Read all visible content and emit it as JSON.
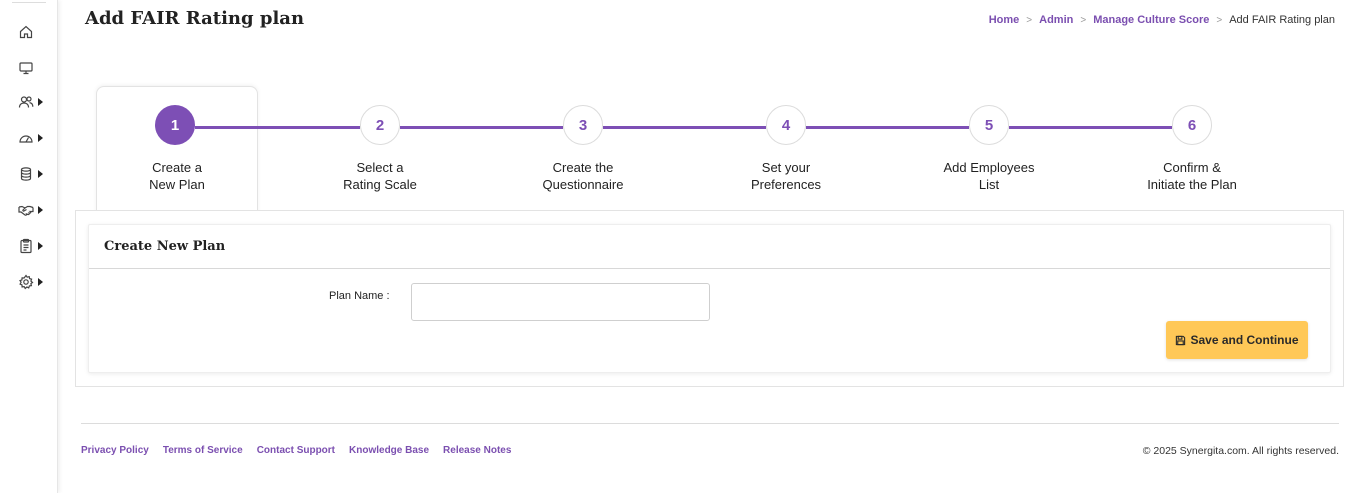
{
  "header": {
    "title": "Add FAIR Rating plan",
    "breadcrumb": [
      "Home",
      "Admin",
      "Manage Culture Score",
      "Add FAIR Rating plan"
    ]
  },
  "sidebar": {
    "items": [
      {
        "icon": "home-icon",
        "has_submenu": false
      },
      {
        "icon": "monitor-icon",
        "has_submenu": false
      },
      {
        "icon": "users-icon",
        "has_submenu": true
      },
      {
        "icon": "gauge-icon",
        "has_submenu": true
      },
      {
        "icon": "database-icon",
        "has_submenu": true
      },
      {
        "icon": "handshake-icon",
        "has_submenu": true
      },
      {
        "icon": "clipboard-icon",
        "has_submenu": true
      },
      {
        "icon": "settings-icon",
        "has_submenu": true
      }
    ]
  },
  "stepper": {
    "active_step": 1,
    "accent_color": "#7d4fb5",
    "steps": [
      {
        "number": "1",
        "line1": "Create a",
        "line2": "New Plan"
      },
      {
        "number": "2",
        "line1": "Select a",
        "line2": "Rating Scale"
      },
      {
        "number": "3",
        "line1": "Create the",
        "line2": "Questionnaire"
      },
      {
        "number": "4",
        "line1": "Set your",
        "line2": "Preferences"
      },
      {
        "number": "5",
        "line1": "Add Employees",
        "line2": "List"
      },
      {
        "number": "6",
        "line1": "Confirm &",
        "line2": "Initiate the Plan"
      }
    ]
  },
  "form": {
    "card_title": "Create New Plan",
    "plan_name_label": "Plan Name :",
    "plan_name_value": "",
    "plan_name_placeholder": "",
    "save_button_label": "Save and Continue",
    "save_button_color": "#ffc857"
  },
  "footer": {
    "links": [
      "Privacy Policy",
      "Terms of Service",
      "Contact Support",
      "Knowledge Base",
      "Release Notes"
    ],
    "copyright": "© 2025 Synergita.com. All rights reserved."
  }
}
